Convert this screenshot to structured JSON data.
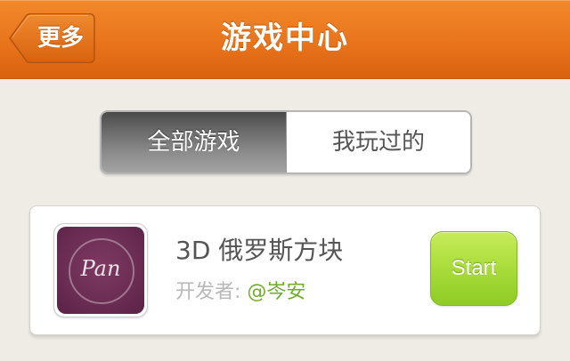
{
  "header": {
    "title": "游戏中心",
    "back_label": "更多"
  },
  "tabs": [
    {
      "label": "全部游戏",
      "selected": true
    },
    {
      "label": "我玩过的",
      "selected": false
    }
  ],
  "games": [
    {
      "title": "3D 俄罗斯方块",
      "developer_label": "开发者: ",
      "developer_name": "@岑安",
      "icon_text": "Pan",
      "action_label": "Start"
    }
  ],
  "colors": {
    "header": "#e9741c",
    "start_button": "#a9dc3a",
    "developer_link": "#6fae2a",
    "icon_background": "#6a2c52"
  }
}
